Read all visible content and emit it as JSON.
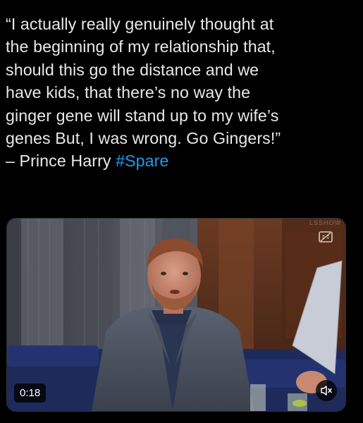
{
  "tweet": {
    "lines": [
      "“I actually really genuinely thought at",
      "the beginning of my relationship that,",
      "should this go the distance and we",
      "have kids, that there’s no way the",
      "ginger gene will stand up to my wife’s",
      "genes But, I was wrong. Go Gingers!”"
    ],
    "attribution": "– Prince Harry ",
    "hashtag": "#Spare"
  },
  "media": {
    "duration": "0:18",
    "mute_icon": "muted-speaker-icon",
    "captions_icon": "closed-captions-icon",
    "top_watermark": "LSSHOW"
  },
  "colors": {
    "background": "#000000",
    "text": "#e7e9ea",
    "hashtag": "#1d9bf0"
  }
}
